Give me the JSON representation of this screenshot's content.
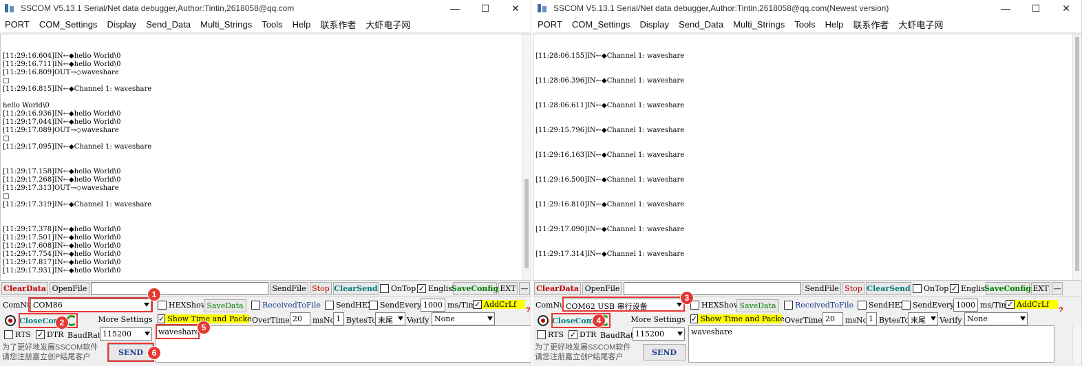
{
  "left": {
    "title": "SSCOM V5.13.1 Serial/Net data debugger,Author:Tintin,2618058@qq.com",
    "menu": [
      "PORT",
      "COM_Settings",
      "Display",
      "Send_Data",
      "Multi_Strings",
      "Tools",
      "Help",
      "联系作者",
      "大虾电子网"
    ],
    "log": [
      "",
      "",
      "[11:29:16.604]IN←◆hello World\\0",
      "[11:29:16.711]IN←◆hello World\\0",
      "[11:29:16.809]OUT→◇waveshare",
      "□",
      "[11:29:16.815]IN←◆Channel 1: waveshare",
      "",
      "hello World\\0",
      "[11:29:16.936]IN←◆hello World\\0",
      "[11:29:17.044]IN←◆hello World\\0",
      "[11:29:17.089]OUT→◇waveshare",
      "□",
      "[11:29:17.095]IN←◆Channel 1: waveshare",
      "",
      "",
      "[11:29:17.158]IN←◆hello World\\0",
      "[11:29:17.268]IN←◆hello World\\0",
      "[11:29:17.313]OUT→◇waveshare",
      "□",
      "[11:29:17.319]IN←◆Channel 1: waveshare",
      "",
      "",
      "[11:29:17.378]IN←◆hello World\\0",
      "[11:29:17.501]IN←◆hello World\\0",
      "[11:29:17.608]IN←◆hello World\\0",
      "[11:29:17.754]IN←◆hello World\\0",
      "[11:29:17.817]IN←◆hello World\\0",
      "[11:29:17.931]IN←◆hello World\\0"
    ],
    "toolbar": {
      "clear_data": "ClearData",
      "open_file": "OpenFile",
      "send_file": "SendFile",
      "stop": "Stop",
      "clear_send": "ClearSend",
      "on_top": "OnTop",
      "english": "English",
      "save_config": "SaveConfig",
      "ext": "EXT",
      "dash": "—"
    },
    "port": {
      "com_num_label": "ComNum",
      "com_num_value": "COM86",
      "close_com": "CloseCom",
      "more_settings": "More Settings",
      "rts": "RTS",
      "dtr": "DTR",
      "baud_label": "BaudRate",
      "baud_value": "115200"
    },
    "options": {
      "hex_show": "HEXShow",
      "save_data": "SaveData",
      "received_to_file": "ReceivedToFile",
      "send_hex": "SendHEX",
      "send_every": "SendEvery:",
      "send_every_value": "1000",
      "ms_tim": "ms/Tim",
      "add_crlf": "AddCrLf",
      "show_time": "Show Time and Packe",
      "over_time": "OverTime:",
      "over_time_value": "20",
      "ms": "ms",
      "no": "No",
      "no_value": "1",
      "bytes_to": "BytesTo",
      "bytes_to_value": "末尾",
      "verify": "Verify",
      "verify_value": "None"
    },
    "send_text": "waveshare",
    "send_button": "SEND",
    "footer_line1": "为了更好地发展SSCOM软件",
    "footer_line2": "请您注册嘉立创P结尾客户"
  },
  "right": {
    "title": "SSCOM V5.13.1 Serial/Net data debugger,Author:Tintin,2618058@qq.com(Newest version)",
    "menu": [
      "PORT",
      "COM_Settings",
      "Display",
      "Send_Data",
      "Multi_Strings",
      "Tools",
      "Help",
      "联系作者",
      "大虾电子网"
    ],
    "log": [
      "",
      "[11:28:06.155]IN←◆Channel 1: waveshare",
      "",
      "[11:28:06.396]IN←◆Channel 1: waveshare",
      "",
      "[11:28:06.611]IN←◆Channel 1: waveshare",
      "",
      "[11:29:15.796]IN←◆Channel 1: waveshare",
      "",
      "[11:29:16.163]IN←◆Channel 1: waveshare",
      "",
      "[11:29:16.500]IN←◆Channel 1: waveshare",
      "",
      "[11:29:16.810]IN←◆Channel 1: waveshare",
      "",
      "[11:29:17.090]IN←◆Channel 1: waveshare",
      "",
      "[11:29:17.314]IN←◆Channel 1: waveshare"
    ],
    "toolbar": {
      "clear_data": "ClearData",
      "open_file": "OpenFile",
      "send_file": "SendFile",
      "stop": "Stop",
      "clear_send": "ClearSend",
      "on_top": "OnTop",
      "english": "English",
      "save_config": "SaveConfig",
      "ext": "EXT",
      "dash": "—"
    },
    "port": {
      "com_num_label": "ComNum",
      "com_num_value": "COM62 USB 串行设备",
      "close_com": "CloseCom",
      "more_settings": "More Settings",
      "rts": "RTS",
      "dtr": "DTR",
      "baud_label": "BaudRate",
      "baud_value": "115200"
    },
    "options": {
      "hex_show": "HEXShow",
      "save_data": "SaveData",
      "received_to_file": "ReceivedToFile",
      "send_hex": "SendHEX",
      "send_every": "SendEvery:",
      "send_every_value": "1000",
      "ms_tim": "ms/Tim",
      "add_crlf": "AddCrLf",
      "show_time": "Show Time and Packe",
      "over_time": "OverTime:",
      "over_time_value": "20",
      "ms": "ms",
      "no": "No",
      "no_value": "1",
      "bytes_to": "BytesTo",
      "bytes_to_value": "末尾",
      "verify": "Verify",
      "verify_value": "None"
    },
    "send_text": "waveshare",
    "send_button": "SEND",
    "footer_line1": "为了更好地发展SSCOM软件",
    "footer_line2": "请您注册嘉立创P结尾客户"
  },
  "window_controls": [
    "—",
    "☐",
    "✕"
  ],
  "badges": [
    "1",
    "2",
    "3",
    "4",
    "5",
    "6"
  ],
  "check_mark": "✓",
  "question_mark": "?",
  "colors": {
    "annotation_red": "#e53935",
    "highlight_yellow": "#ffff00",
    "clear_data_red": "#c00000",
    "save_green": "#008000"
  }
}
